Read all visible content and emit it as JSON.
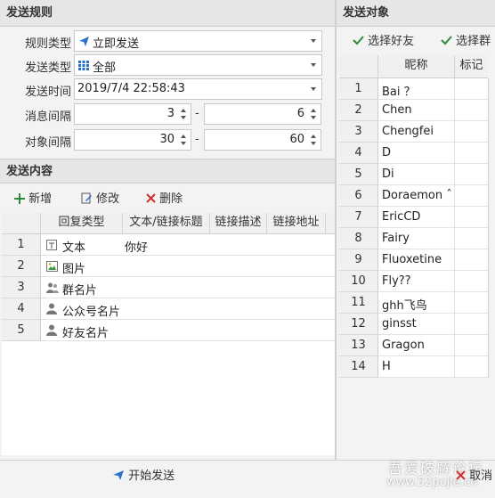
{
  "send_rules": {
    "title": "发送规则",
    "rule_type_label": "规则类型",
    "rule_type_value": "立即发送",
    "send_type_label": "发送类型",
    "send_type_value": "全部",
    "send_time_label": "发送时间",
    "send_time_value": "2019/7/4 22:58:43",
    "msg_interval_label": "消息间隔",
    "msg_interval_min": "3",
    "msg_interval_max": "6",
    "target_interval_label": "对象间隔",
    "target_interval_min": "30",
    "target_interval_max": "60",
    "range_sep": "-"
  },
  "content": {
    "title": "发送内容",
    "add_label": "新增",
    "edit_label": "修改",
    "delete_label": "删除",
    "columns": [
      "回复类型",
      "文本/链接标题",
      "链接描述",
      "链接地址"
    ],
    "rows": [
      {
        "num": "1",
        "type": "文本",
        "text": "你好",
        "icon": "text-icon"
      },
      {
        "num": "2",
        "type": "图片",
        "text": "",
        "icon": "image-icon"
      },
      {
        "num": "3",
        "type": "群名片",
        "text": "",
        "icon": "group-card-icon"
      },
      {
        "num": "4",
        "type": "公众号名片",
        "text": "",
        "icon": "official-account-card-icon"
      },
      {
        "num": "5",
        "type": "好友名片",
        "text": "",
        "icon": "friend-card-icon"
      }
    ]
  },
  "targets": {
    "title": "发送对象",
    "select_friends_label": "选择好友",
    "select_groups_label": "选择群",
    "columns": [
      "昵称",
      "标记"
    ],
    "rows": [
      {
        "num": "1",
        "name": "Bai ？"
      },
      {
        "num": "2",
        "name": "Chen"
      },
      {
        "num": "3",
        "name": "Chengfei"
      },
      {
        "num": "4",
        "name": "D"
      },
      {
        "num": "5",
        "name": "Di"
      },
      {
        "num": "6",
        "name": "Doraemon ˆ"
      },
      {
        "num": "7",
        "name": "EricCD"
      },
      {
        "num": "8",
        "name": "Fairy"
      },
      {
        "num": "9",
        "name": "Fluoxetine"
      },
      {
        "num": "10",
        "name": "Fly??"
      },
      {
        "num": "11",
        "name": "ghh飞鸟"
      },
      {
        "num": "12",
        "name": "ginsst"
      },
      {
        "num": "13",
        "name": "Gragon"
      },
      {
        "num": "14",
        "name": "H"
      }
    ]
  },
  "footer": {
    "start_label": "开始发送",
    "cancel_label": "取消",
    "watermark": "吾爱破解论坛",
    "watermark_url": "www.52pojie.cn"
  },
  "colors": {
    "accent_blue": "#2a6fc9",
    "check_green": "#2f8a3a",
    "delete_red": "#d03030",
    "header_bg": "#e6e6e6"
  }
}
